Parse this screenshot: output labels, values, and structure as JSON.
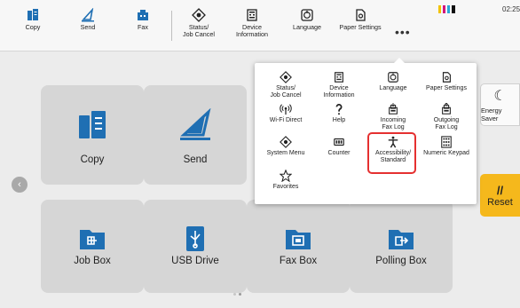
{
  "topbar": {
    "items": [
      {
        "label": "Copy",
        "icon": "copy-icon"
      },
      {
        "label": "Send",
        "icon": "send-icon"
      },
      {
        "label": "Fax",
        "icon": "fax-icon"
      },
      {
        "label": "Status/\nJob Cancel",
        "icon": "status-icon"
      },
      {
        "label": "Device\nInformation",
        "icon": "device-info-icon"
      },
      {
        "label": "Language",
        "icon": "language-icon"
      },
      {
        "label": "Paper Settings",
        "icon": "paper-settings-icon"
      }
    ],
    "more_label": "•••",
    "clock": "02:25",
    "status_colors": [
      "#f2c200",
      "#d4157a",
      "#2aa6d8",
      "#111111"
    ]
  },
  "tiles": [
    {
      "label": "Copy",
      "icon": "copy-icon"
    },
    {
      "label": "Send",
      "icon": "send-icon"
    },
    {
      "label": "Job Box",
      "icon": "job-box-icon"
    },
    {
      "label": "USB Drive",
      "icon": "usb-drive-icon"
    },
    {
      "label": "Fax Box",
      "icon": "fax-box-icon"
    },
    {
      "label": "Polling Box",
      "icon": "polling-box-icon"
    }
  ],
  "side": {
    "energy_label": "Energy Saver",
    "reset_label": "Reset"
  },
  "popup": {
    "items": [
      {
        "label": "Status/\nJob Cancel",
        "icon": "status-icon"
      },
      {
        "label": "Device\nInformation",
        "icon": "device-info-icon"
      },
      {
        "label": "Language",
        "icon": "language-icon"
      },
      {
        "label": "Paper Settings",
        "icon": "paper-settings-icon"
      },
      {
        "label": "Wi-Fi Direct",
        "icon": "wifi-direct-icon"
      },
      {
        "label": "Help",
        "icon": "help-icon"
      },
      {
        "label": "Incoming\nFax Log",
        "icon": "incoming-fax-log-icon"
      },
      {
        "label": "Outgoing\nFax Log",
        "icon": "outgoing-fax-log-icon"
      },
      {
        "label": "System Menu",
        "icon": "system-menu-icon"
      },
      {
        "label": "Counter",
        "icon": "counter-icon"
      },
      {
        "label": "Accessibility/\nStandard",
        "icon": "accessibility-icon"
      },
      {
        "label": "Numeric Keypad",
        "icon": "numeric-keypad-icon"
      },
      {
        "label": "Favorites",
        "icon": "favorites-icon"
      }
    ]
  },
  "colors": {
    "tile_bg": "#d6d6d6",
    "accent_blue": "#1f6fb3",
    "reset": "#f5b81c",
    "highlight": "#e53030"
  }
}
